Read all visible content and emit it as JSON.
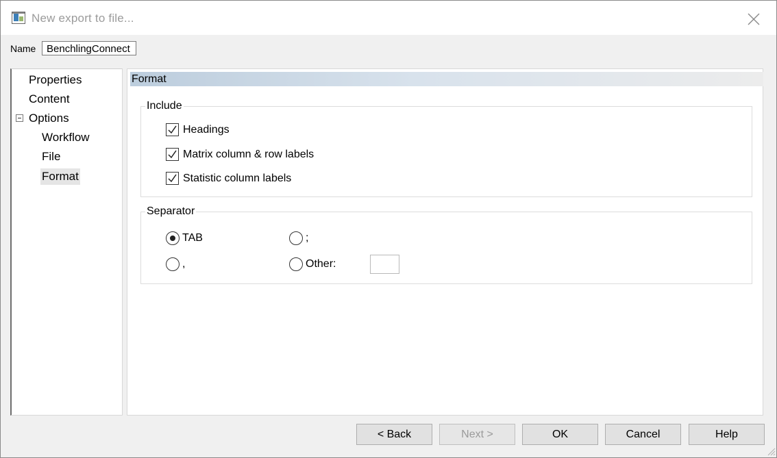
{
  "window": {
    "title": "New export to file..."
  },
  "name_field": {
    "label": "Name",
    "value": "BenchlingConnect"
  },
  "tree": {
    "items": [
      {
        "label": "Properties"
      },
      {
        "label": "Content"
      },
      {
        "label": "Options"
      },
      {
        "label": "Workflow"
      },
      {
        "label": "File"
      },
      {
        "label": "Format"
      }
    ],
    "selected": "Format"
  },
  "section": {
    "title": "Format"
  },
  "include": {
    "title": "Include",
    "options": [
      {
        "label": "Headings",
        "checked": true
      },
      {
        "label": "Matrix column & row labels",
        "checked": true
      },
      {
        "label": "Statistic column labels",
        "checked": true
      }
    ]
  },
  "separator": {
    "title": "Separator",
    "options": [
      {
        "label": "TAB",
        "selected": true
      },
      {
        "label": ";",
        "selected": false
      },
      {
        "label": ",",
        "selected": false
      },
      {
        "label": "Other:",
        "selected": false
      }
    ],
    "other_value": ""
  },
  "buttons": {
    "back": "< Back",
    "next": "Next >",
    "ok": "OK",
    "cancel": "Cancel",
    "help": "Help"
  },
  "colors": {
    "header_gradient_start": "#bccddd",
    "disabled_text": "#9a9a9a"
  }
}
